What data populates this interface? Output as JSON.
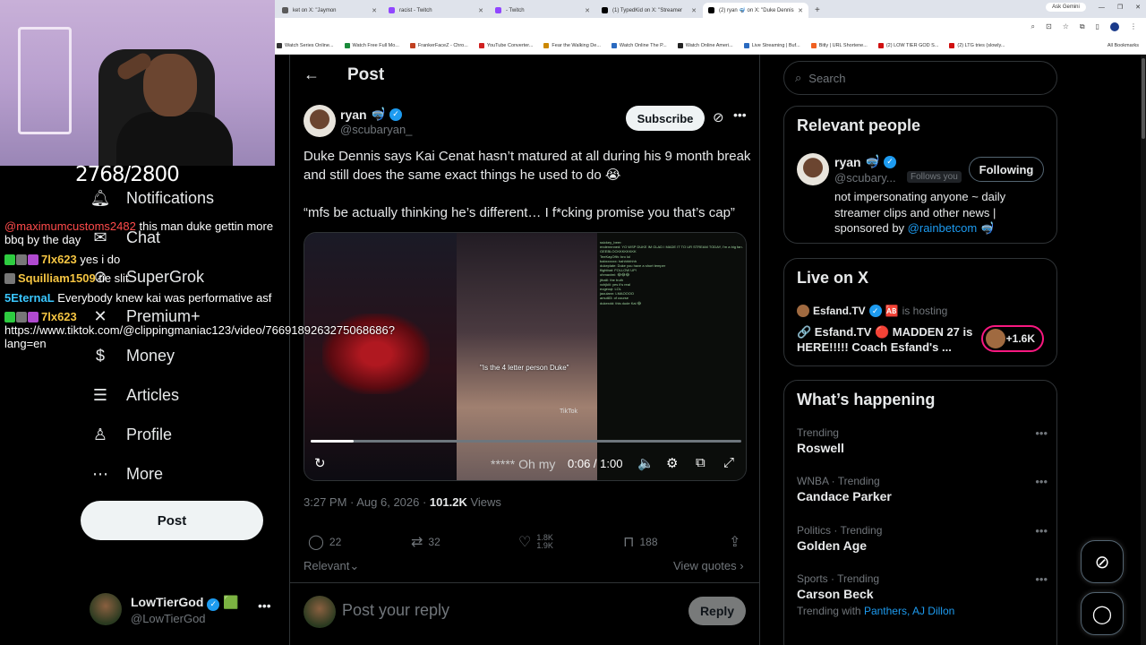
{
  "browser": {
    "tabs": [
      {
        "label": "ket on X: \"Jaymon",
        "color": "#5a5a5a",
        "active": false
      },
      {
        "label": "racist - Twitch",
        "color": "#9146ff",
        "active": false
      },
      {
        "label": "- Twitch",
        "color": "#9146ff",
        "active": false
      },
      {
        "label": "(1) TypedKid on X: \"Streamer",
        "color": "#000000",
        "active": false
      },
      {
        "label": "(2) ryan 🤿 on X: \"Duke Dennis",
        "color": "#000000",
        "active": true
      }
    ],
    "ask_gemini": "Ask Gemini",
    "bookmarks": [
      "Watch Series Online...",
      "Watch Free Full Mo...",
      "FrankerFaceZ - Chro...",
      "YouTube Converter...",
      "Fear the Walking De...",
      "Watch Online The P...",
      "Watch Online Ameri...",
      "Live Streaming | Buf...",
      "Bitly | URL Shortene...",
      "(2) LOW TIER GOD S...",
      "(2) LTG tries (slowly..."
    ],
    "all_bookmarks": "All Bookmarks"
  },
  "stream_overlay": {
    "counter": "2768/2800",
    "chat": [
      {
        "user": "@maximumcustoms2482",
        "text": " this man duke gettin more bbq by the day",
        "style": "u1"
      },
      {
        "user": "7lx623",
        "text": " yes i do",
        "style": "u2",
        "badges": true
      },
      {
        "user": "Squilliam1509",
        "text": " tie slit",
        "style": "u2",
        "badges": false
      },
      {
        "user": "5EternaL",
        "text": " Everybody knew kai was performative asf",
        "style": "u3",
        "badges": false
      },
      {
        "user": "7lx623",
        "text": " https://www.tiktok.com/@clippingmaniac123/video/7669189263275068686?lang=en",
        "style": "u2",
        "badges": true
      }
    ]
  },
  "sidebar": {
    "items": [
      {
        "label": "Notifications",
        "icon": "bell-icon"
      },
      {
        "label": "Chat",
        "icon": "chat-icon"
      },
      {
        "label": "SuperGrok",
        "icon": "grok-icon"
      },
      {
        "label": "Premium+",
        "icon": "x-logo-icon"
      },
      {
        "label": "Money",
        "icon": "money-icon"
      },
      {
        "label": "Articles",
        "icon": "articles-icon"
      },
      {
        "label": "Profile",
        "icon": "profile-icon"
      },
      {
        "label": "More",
        "icon": "more-circle-icon"
      }
    ],
    "post_button": "Post",
    "account": {
      "name": "LowTierGod",
      "handle": "@LowTierGod",
      "emoji": "🟩"
    }
  },
  "post": {
    "header_title": "Post",
    "author": {
      "name": "ryan",
      "emoji": "🤿",
      "handle": "@scubaryan_"
    },
    "subscribe_label": "Subscribe",
    "text_1": "Duke Dennis says Kai Cenat hasn’t matured at all during his 9 month break and still does the same exact things he used to do 😭",
    "text_2": "“mfs be actually thinking he’s different… I f*cking promise you that’s cap”",
    "video": {
      "caption": "\"Is the 4 letter person Duke\"",
      "tiktok": "TikTok",
      "subtitle": "***** Oh my",
      "time": "0:06 / 1:00",
      "progress": 0.1,
      "chat_lines": [
        "ssickey_beer:",
        "endennnned: YO WSP DUKE IM GLAD I MADE IT TO UR STREAM TODAY, I'm a big fan.",
        "GEEBLOCKKKKKKKK",
        "TeeKayOfth: bro lol",
        "babxxxxxx: hahhhhhhh",
        "dukeplate: Duke you have a short temper",
        "flightbat: FOLLOW UP!",
        "ohmaximi: 😂😂😂",
        "jthalil: the truth",
        "xchjkiii: yes it's real",
        "eogeoqi: LOL",
        "jaouiann: LMAOOOO",
        "amut83: of course",
        "dukexdd: this dude Kai 😂"
      ]
    },
    "timestamp": "3:27 PM · Aug 6, 2026 · ",
    "views_count": "101.2K",
    "views_label": " Views",
    "stats": {
      "replies": "22",
      "reposts": "32",
      "likes_top": "1.8K",
      "likes_bottom": "1.9K",
      "bookmarks": "188"
    },
    "relevant": "Relevant",
    "view_quotes": "View quotes",
    "reply_placeholder": "Post your reply",
    "reply_button": "Reply"
  },
  "right": {
    "search_placeholder": "Search",
    "relevant_people": {
      "title": "Relevant people",
      "name": "ryan",
      "emoji": "🤿",
      "handle": "@scubary...",
      "follows_you": "Follows you",
      "following": "Following",
      "bio": "not impersonating anyone ~ daily streamer clips and other news | sponsored by ",
      "bio_link": "@rainbetcom",
      "bio_end": " 🤿"
    },
    "live": {
      "title": "Live on X",
      "host": "Esfand.TV",
      "host_badge": "🆎",
      "hosting": "is hosting",
      "stream_title": "🔗 Esfand.TV 🔴 MADDEN 27 is HERE!!!!! Coach Esfand's ...",
      "viewers": "+1.6K"
    },
    "happening": {
      "title": "What’s happening",
      "trends": [
        {
          "context": "Trending",
          "name": "Roswell",
          "with": null
        },
        {
          "context": "WNBA · Trending",
          "name": "Candace Parker",
          "with": null
        },
        {
          "context": "Politics · Trending",
          "name": "Golden Age",
          "with": null
        },
        {
          "context": "Sports · Trending",
          "name": "Carson Beck",
          "with_label": "Trending with ",
          "with": "Panthers, AJ Dillon"
        }
      ]
    }
  },
  "colors": {
    "accent": "#1d9bf0",
    "bg": "#000000",
    "border": "#2f3336",
    "muted": "#71767b"
  }
}
